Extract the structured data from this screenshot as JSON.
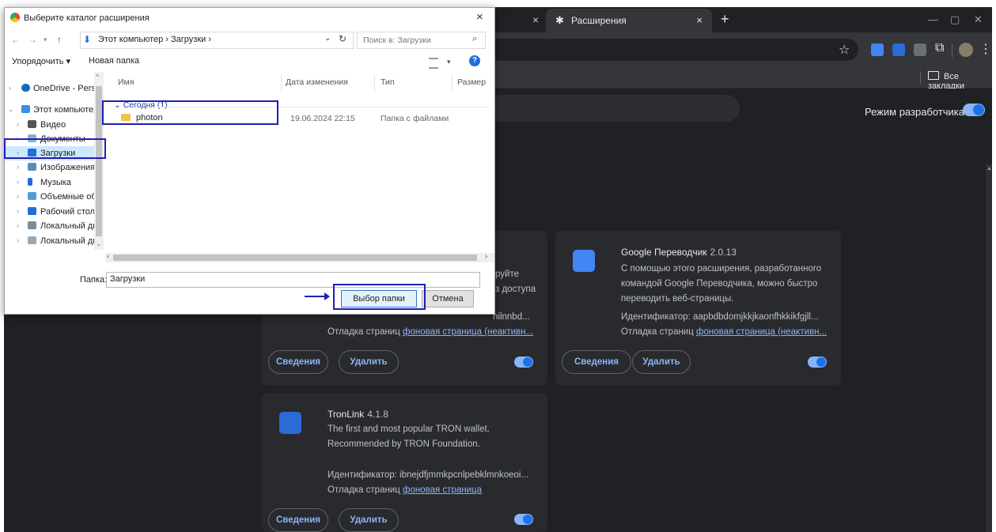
{
  "browser": {
    "tab_title": "Расширения",
    "tab_icon": "puzzle-icon",
    "new_tab_symbol": "+",
    "close_symbol": "×",
    "bookmarks_all": "Все закладки"
  },
  "extensions_page": {
    "dev_mode_label": "Режим разработчика",
    "dev_mode_on": true,
    "cards": [
      {
        "partial_desc_lines": [
          "руйте",
          "з доступа"
        ],
        "id_partial": "nilnnbd...",
        "debug_prefix": "Отладка страниц",
        "debug_link": "фоновая страница (неактивн...",
        "details_label": "Сведения",
        "remove_label": "Удалить",
        "enabled": true
      },
      {
        "name": "Google Переводчик",
        "version": "2.0.13",
        "desc_lines": [
          "С помощью этого расширения, разработанного",
          "командой Google Переводчика, можно быстро",
          "переводить веб-страницы."
        ],
        "id_line": "Идентификатор: aapbdbdomjkkjkaonfhkkikfgjll...",
        "debug_prefix": "Отладка страниц",
        "debug_link": "фоновая страница (неактивн...",
        "details_label": "Сведения",
        "remove_label": "Удалить",
        "enabled": true,
        "icon_color": "#4285f4"
      },
      {
        "name": "TronLink",
        "version": "4.1.8",
        "desc_lines": [
          "The first and most popular TRON wallet.",
          "Recommended by TRON Foundation."
        ],
        "id_line": "Идентификатор: ibnejdfjmmkpcnlpebklmnkoeoi...",
        "debug_prefix": "Отладка страниц",
        "debug_link": "фоновая страница",
        "details_label": "Сведения",
        "remove_label": "Удалить",
        "enabled": true,
        "icon_color": "#2b6bd6"
      }
    ]
  },
  "dialog": {
    "title": "Выберите каталог расширения",
    "close_symbol": "×",
    "path": "Этот компьютер  ›  Загрузки  ›",
    "search_placeholder": "Поиск в: Загрузки",
    "organize_label": "Упорядочить ▾",
    "new_folder_label": "Новая папка",
    "help_symbol": "?",
    "tree": [
      {
        "label": "OneDrive - Person",
        "icon": "cloud-icon"
      },
      {
        "label": "Этот компьютер",
        "icon": "computer-icon"
      },
      {
        "label": "Видео",
        "icon": "video-icon"
      },
      {
        "label": "Документы",
        "icon": "documents-icon"
      },
      {
        "label": "Загрузки",
        "icon": "downloads-icon",
        "selected": true
      },
      {
        "label": "Изображения",
        "icon": "pictures-icon"
      },
      {
        "label": "Музыка",
        "icon": "music-icon"
      },
      {
        "label": "Объемные объ",
        "icon": "3d-objects-icon"
      },
      {
        "label": "Рабочий стол",
        "icon": "desktop-icon"
      },
      {
        "label": "Локальный дис",
        "icon": "drive-icon"
      },
      {
        "label": "Локальный дис",
        "icon": "drive-icon"
      }
    ],
    "columns": [
      "Имя",
      "Дата изменения",
      "Тип",
      "Размер"
    ],
    "group_label": "Сегодня (1)",
    "files": [
      {
        "name": "photon",
        "date": "19.06.2024 22:15",
        "type": "Папка с файлами"
      }
    ],
    "folder_label": "Папка:",
    "folder_value": "Загрузки",
    "select_button": "Выбор папки",
    "cancel_button": "Отмена"
  },
  "colors": {
    "chrome_bg": "#202124",
    "card_bg": "#292a2d",
    "link_blue": "#8ab4f8",
    "annotation_blue": "#1f1fb5",
    "selection_blue": "#cce8ff"
  }
}
